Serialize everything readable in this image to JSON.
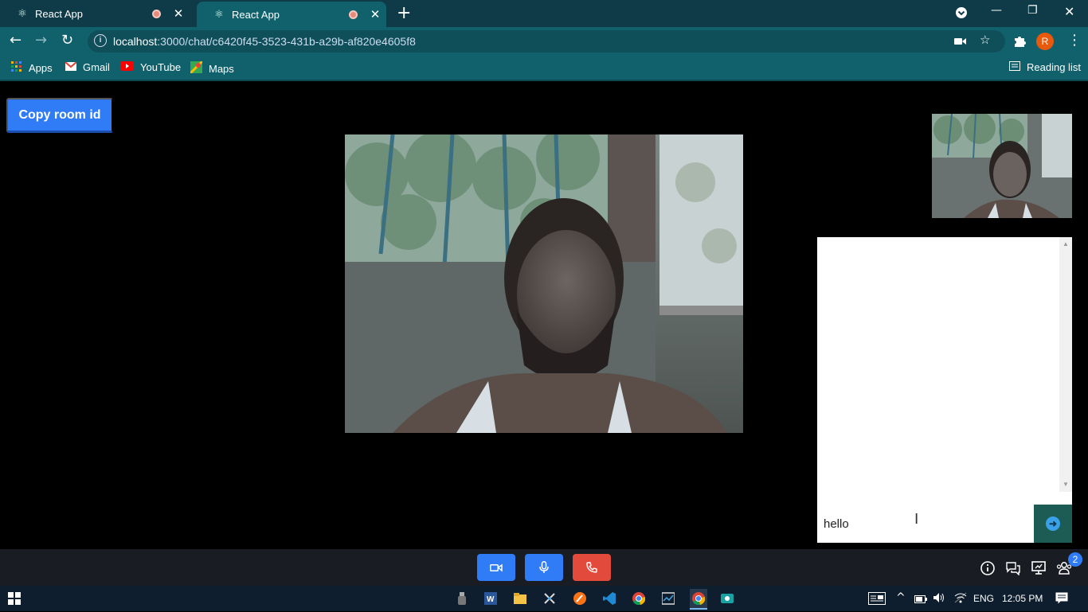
{
  "browser": {
    "tabs": [
      {
        "title": "React App"
      },
      {
        "title": "React App"
      }
    ],
    "url_host": "localhost",
    "url_rest": ":3000/chat/c6420f45-3523-431b-a29b-af820e4605f8",
    "avatar_letter": "R",
    "reading_list": "Reading list",
    "bookmarks": [
      {
        "label": "Apps",
        "icon": "apps-grid-icon"
      },
      {
        "label": "Gmail",
        "icon": "gmail-icon"
      },
      {
        "label": "YouTube",
        "icon": "youtube-icon"
      },
      {
        "label": "Maps",
        "icon": "maps-icon"
      }
    ]
  },
  "page": {
    "copy_button": "Copy room id",
    "chat_input_value": "hello"
  },
  "controls": {
    "participants_badge": "2"
  },
  "taskbar": {
    "lang": "ENG",
    "time": "12:05 PM"
  },
  "colors": {
    "tab_strip": "#0f3b49",
    "toolbar": "#11616d",
    "accent_blue": "#2f7cf6",
    "end_call_red": "#e24b3b",
    "send_green": "#1d5c55"
  }
}
